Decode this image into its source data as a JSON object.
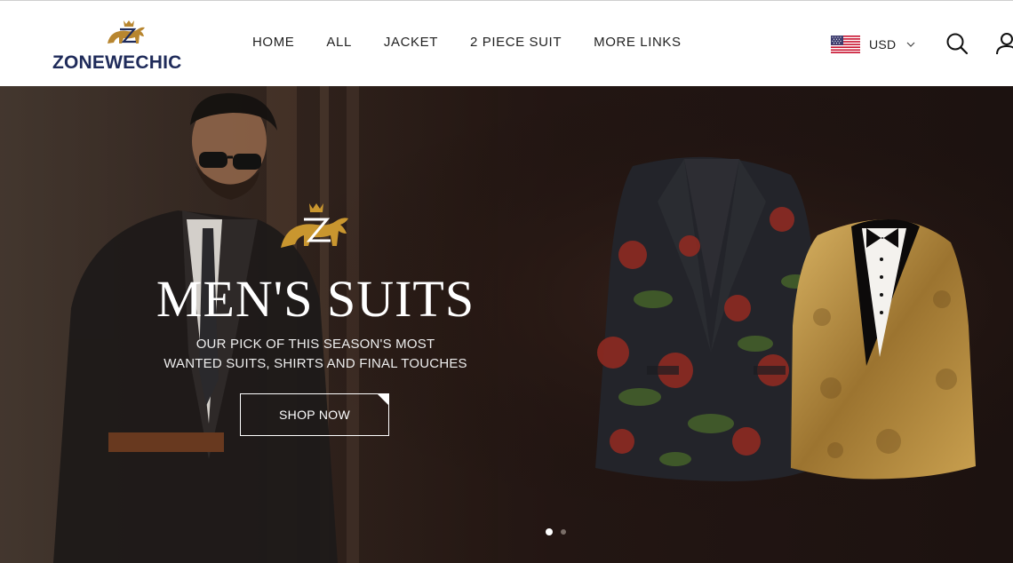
{
  "brand": {
    "name": "ZONEWECHIC",
    "color": "#1f2b5a",
    "mark_color": "#b8862f"
  },
  "nav": {
    "items": [
      {
        "label": "HOME"
      },
      {
        "label": "ALL"
      },
      {
        "label": "JACKET"
      },
      {
        "label": "2 PIECE SUIT"
      },
      {
        "label": "MORE LINKS"
      }
    ]
  },
  "currency": {
    "selected": "USD",
    "flag_icon": "us-flag-icon"
  },
  "icons": {
    "search": "search-icon",
    "account": "user-icon",
    "dropdown": "chevron-down-icon"
  },
  "hero": {
    "title": "MEN'S SUITS",
    "subtitle_line1": "OUR PICK OF THIS SEASON'S MOST",
    "subtitle_line2": "WANTED SUITS, SHIRTS AND FINAL TOUCHES",
    "cta_label": "SHOP NOW",
    "slides": {
      "count": 2,
      "active": 1
    },
    "accent_color": "#c9962f"
  }
}
